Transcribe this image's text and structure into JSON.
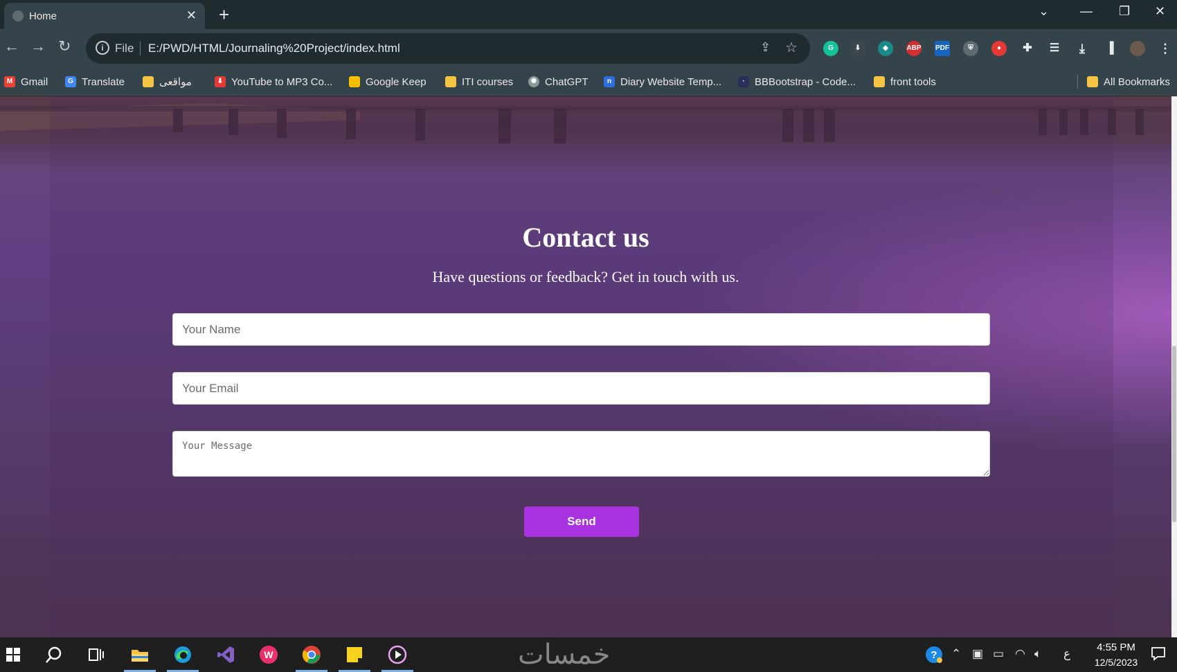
{
  "browser": {
    "tab": {
      "title": "Home"
    },
    "omnibox": {
      "scheme_label": "File",
      "url": "E:/PWD/HTML/Journaling%20Project/index.html"
    },
    "extensions": [
      "grammarly-icon",
      "download-icon",
      "extension-icon",
      "ABP",
      "PDF",
      "shield-icon",
      "record-icon",
      "puzzle-icon",
      "playlist-icon",
      "download-icon",
      "sidebar-icon",
      "avatar"
    ],
    "bookmarks": [
      {
        "label": "Gmail",
        "icon": "gmail-icon",
        "color": "#ea4335"
      },
      {
        "label": "Translate",
        "icon": "translate-icon",
        "color": "#4285f4"
      },
      {
        "label": "مواقعى",
        "icon": "folder-icon",
        "color": "#f4c542"
      },
      {
        "label": "YouTube to MP3 Co...",
        "icon": "download-icon",
        "color": "#e53935"
      },
      {
        "label": "Google Keep",
        "icon": "keep-icon",
        "color": "#fbbc04"
      },
      {
        "label": "ITI courses",
        "icon": "folder-icon",
        "color": "#f4c542"
      },
      {
        "label": "ChatGPT",
        "icon": "chatgpt-icon",
        "color": "#8a9a96"
      },
      {
        "label": "Diary Website Temp...",
        "icon": "n-icon",
        "color": "#2f6fe0"
      },
      {
        "label": "BBBootstrap - Code...",
        "icon": "bbbootstrap-icon",
        "color": "#2c2f5c"
      },
      {
        "label": "front tools",
        "icon": "folder-icon",
        "color": "#f4c542"
      }
    ],
    "all_bookmarks": "All Bookmarks"
  },
  "page": {
    "heading": "Contact us",
    "subheading": "Have questions or feedback? Get in touch with us.",
    "form": {
      "name_placeholder": "Your Name",
      "email_placeholder": "Your Email",
      "message_placeholder": "Your Message",
      "send_label": "Send"
    },
    "accent_color": "#a832e0"
  },
  "taskbar": {
    "apps": [
      "windows-icon",
      "search-icon",
      "task-view-icon",
      "file-explorer-icon",
      "edge-icon",
      "visual-studio-icon",
      "wps-icon",
      "chrome-icon",
      "sticky-notes-icon",
      "media-player-icon"
    ],
    "watermark": "خمسات",
    "language": "ع",
    "time": "4:55 PM",
    "date": "12/5/2023"
  }
}
